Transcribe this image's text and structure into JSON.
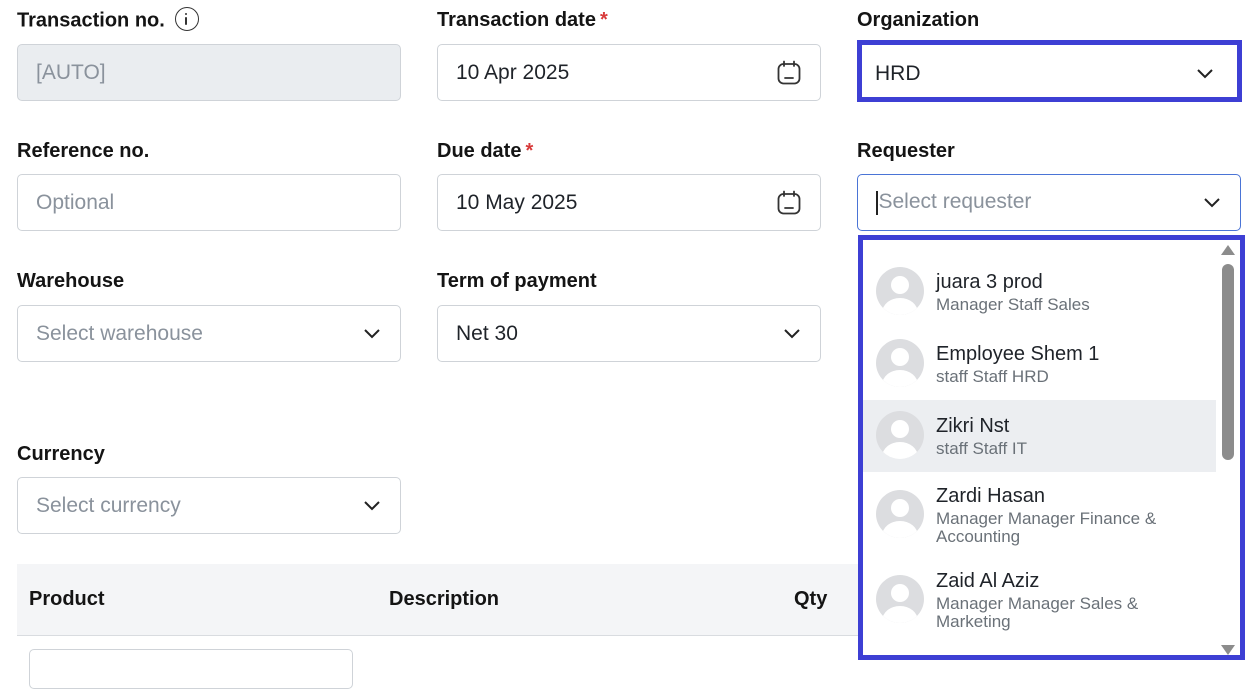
{
  "colors": {
    "outline": "#3d3fd4",
    "required": "#d83a3a",
    "focus": "#4a74d6",
    "highlight": "#eceef1"
  },
  "form": {
    "transaction_no": {
      "label": "Transaction no.",
      "value": "[AUTO]",
      "icon": "info-icon"
    },
    "transaction_date": {
      "label": "Transaction date",
      "required": "*",
      "value": "10 Apr 2025",
      "icon": "calendar-icon"
    },
    "organization": {
      "label": "Organization",
      "value": "HRD"
    },
    "reference_no": {
      "label": "Reference no.",
      "placeholder": "Optional"
    },
    "due_date": {
      "label": "Due date",
      "required": "*",
      "value": "10 May 2025",
      "icon": "calendar-icon"
    },
    "requester": {
      "label": "Requester",
      "placeholder": "Select requester"
    },
    "warehouse": {
      "label": "Warehouse",
      "placeholder": "Select warehouse"
    },
    "term_of_payment": {
      "label": "Term of payment",
      "value": "Net 30"
    },
    "currency": {
      "label": "Currency",
      "placeholder": "Select currency"
    }
  },
  "table": {
    "headers": [
      "Product",
      "Description",
      "Qty"
    ]
  },
  "requester_options": [
    {
      "name": "juara 3 prod",
      "role": "Manager Staff Sales"
    },
    {
      "name": "Employee Shem 1",
      "role": "staff Staff HRD"
    },
    {
      "name": "Zikri Nst",
      "role": "staff Staff IT"
    },
    {
      "name": "Zardi Hasan",
      "role": "Manager Manager Finance & Accounting"
    },
    {
      "name": "Zaid Al Aziz",
      "role": "Manager Manager Sales & Marketing"
    }
  ]
}
